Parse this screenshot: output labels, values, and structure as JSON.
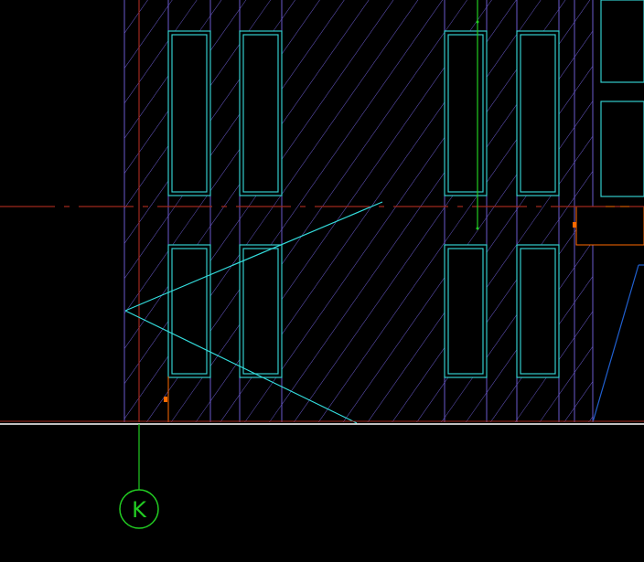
{
  "drawing": {
    "background_color": "#000000",
    "grid_bubble": {
      "label": "K",
      "color": "#22cc22"
    },
    "colors": {
      "wall_outline": "#6a5acd",
      "hatch": "#6a5acd",
      "window": "#33cccc",
      "centerline": "#a0281e",
      "ground_line": "#ffffff",
      "guide_green": "#22cc22",
      "marker": "#ff6a00",
      "slope_line": "#2060d0"
    },
    "icons": [
      "grid-bubble-icon"
    ]
  }
}
